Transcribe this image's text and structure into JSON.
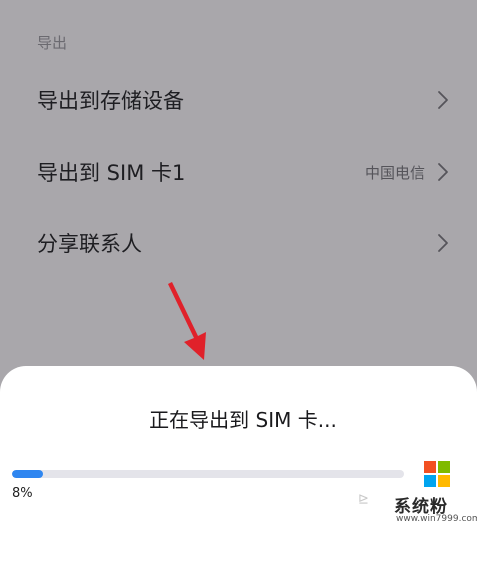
{
  "section": {
    "title": "导出"
  },
  "menu": [
    {
      "label": "导出到存储设备",
      "value": ""
    },
    {
      "label": "导出到 SIM 卡1",
      "value": "中国电信"
    },
    {
      "label": "分享联系人",
      "value": ""
    }
  ],
  "dialog": {
    "title": "正在导出到 SIM 卡...",
    "progress_text": "8%",
    "progress_fraction": 0.08
  },
  "watermark": {
    "text": "系统粉",
    "url": "www.win7999.com",
    "icon": "windows-logo-icon"
  },
  "colors": {
    "accent": "#2f86f0",
    "annotation_arrow": "#e0212a",
    "dim_background": "#a9a7ab"
  }
}
